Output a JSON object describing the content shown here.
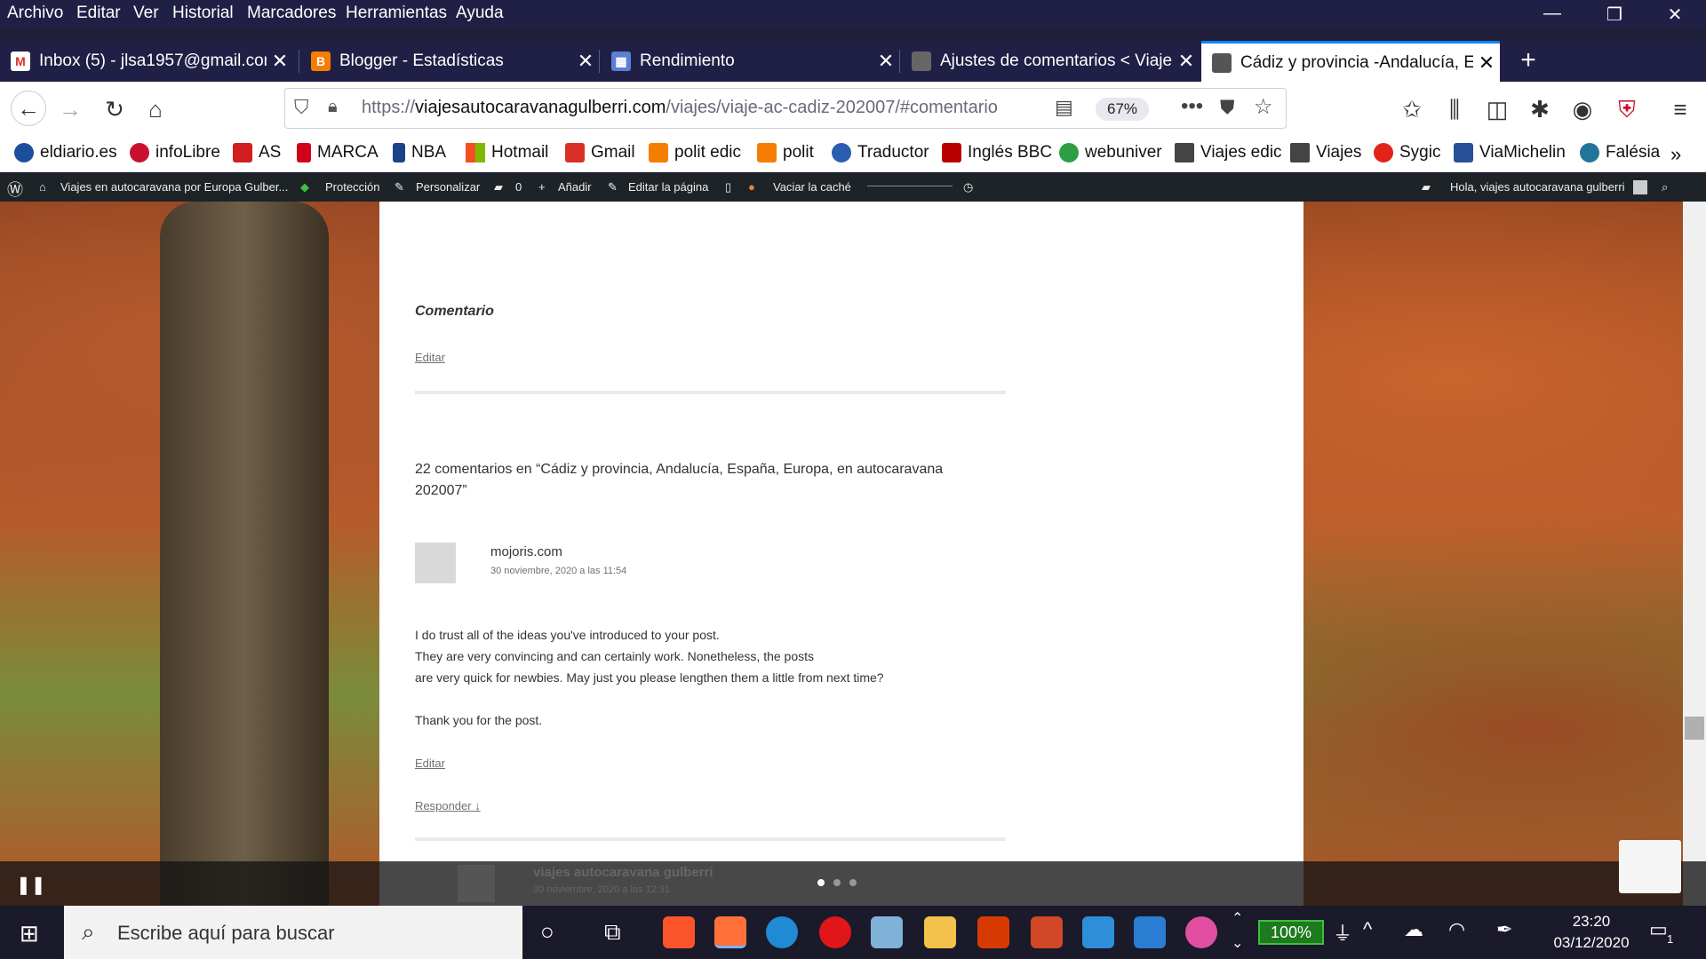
{
  "menubar": {
    "items": [
      "Archivo",
      "Editar",
      "Ver",
      "Historial",
      "Marcadores",
      "Herramientas",
      "Ayuda"
    ]
  },
  "tabs": [
    {
      "title": "Inbox (5) - jlsa1957@gmail.com",
      "icon": "gmail-icon",
      "color": "#d93025"
    },
    {
      "title": "Blogger - Estadísticas",
      "icon": "blogger-icon",
      "color": "#f57d00"
    },
    {
      "title": "Rendimiento",
      "icon": "dashboard-icon",
      "color": "#5a7fd6"
    },
    {
      "title": "Ajustes de comentarios < Viaje",
      "icon": "site-thumbnail-icon",
      "color": "#666666"
    },
    {
      "title": "Cádiz y provincia -Andalucía, Es",
      "icon": "site-thumbnail-icon",
      "color": "#555555"
    }
  ],
  "url": {
    "scheme": "https://",
    "host": "viajesautocaravanagulberri.com",
    "path": "/viajes/viaje-ac-cadiz-202007/#comentario"
  },
  "zoom": "67%",
  "bookmarks": [
    {
      "label": "eldiario.es",
      "color": "#1d4e9e"
    },
    {
      "label": "infoLibre",
      "color": "#c8102e"
    },
    {
      "label": "AS",
      "color": "#d11e1e"
    },
    {
      "label": "MARCA",
      "color": "#d0021b"
    },
    {
      "label": "NBA",
      "color": "#1d428a"
    },
    {
      "label": "Hotmail",
      "color": "#0078d4"
    },
    {
      "label": "Gmail",
      "color": "#d93025"
    },
    {
      "label": "polit edic",
      "color": "#f57d00"
    },
    {
      "label": "polit",
      "color": "#f57d00"
    },
    {
      "label": "Traductor",
      "color": "#2a5db0"
    },
    {
      "label": "Inglés BBC",
      "color": "#b80000"
    },
    {
      "label": "webuniver",
      "color": "#2e9e44"
    },
    {
      "label": "Viajes edic",
      "color": "#444444"
    },
    {
      "label": "Viajes",
      "color": "#444444"
    },
    {
      "label": "Sygic",
      "color": "#e2231a"
    },
    {
      "label": "ViaMichelin",
      "color": "#27509b"
    },
    {
      "label": "Falésia",
      "color": "#21759b"
    }
  ],
  "wpbar": {
    "site": "Viajes en autocaravana por Europa Gulber...",
    "protection": "Protección",
    "customize": "Personalizar",
    "comments_count": "0",
    "add": "Añadir",
    "edit_page": "Editar la página",
    "clear_cache": "Vaciar la caché",
    "greeting": "Hola, viajes autocaravana gulberri"
  },
  "content": {
    "heading": "Comentario",
    "edit_link_1": "Editar",
    "comments_title": "22 comentarios en “Cádiz y provincia, Andalucía, España, Europa, en autocaravana 202007”",
    "comment": {
      "author": "mojoris.com",
      "date": "30 noviembre, 2020 a las 11:54",
      "lines": [
        "I do trust all of the ideas you've introduced to your post.",
        "They are very convincing and can certainly work. Nonetheless, the posts",
        "are very quick for newbies. May just you please lengthen them a little from next time?"
      ],
      "thanks": "Thank you for the post.",
      "edit_link": "Editar",
      "reply_link": "Responder ↓"
    },
    "next_comment": {
      "author": "viajes autocaravana gulberri",
      "date": "30 noviembre, 2020 a las 12:31"
    }
  },
  "taskbar": {
    "search_placeholder": "Escribe aquí para buscar",
    "battery": "100%",
    "time": "23:20",
    "date": "03/12/2020",
    "notifications": "1"
  }
}
